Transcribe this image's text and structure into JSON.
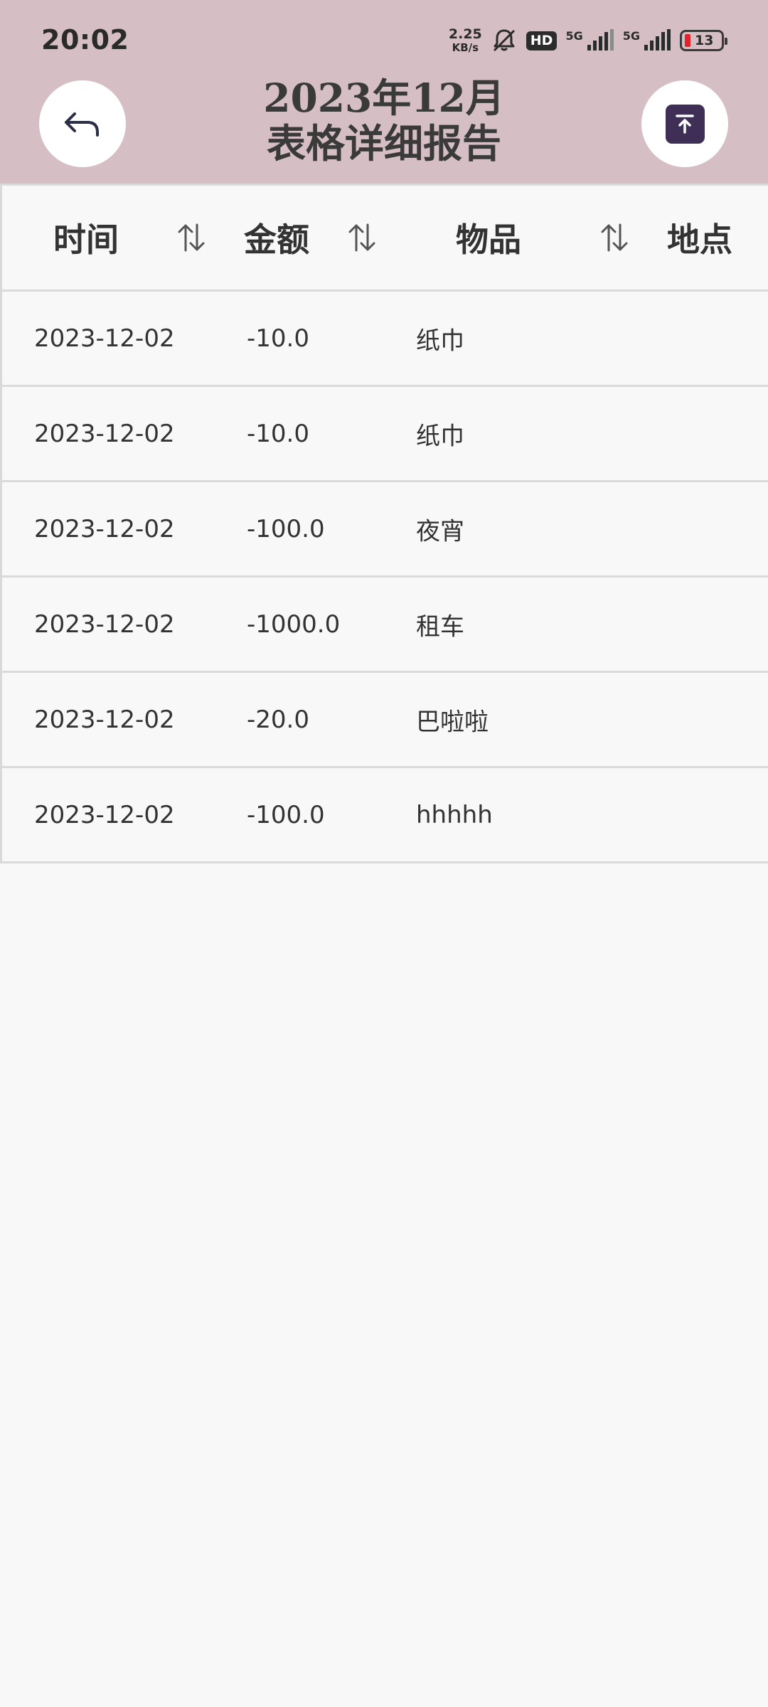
{
  "status_bar": {
    "time": "20:02",
    "net_speed_value": "2.25",
    "net_speed_unit": "KB/s",
    "hd_label": "HD",
    "sim1_label": "5G",
    "sim2_label": "5G",
    "battery": "13"
  },
  "header": {
    "title_line1": "2023年12月",
    "title_line2": "表格详细报告",
    "back_icon": "back-arrow-icon",
    "top_icon": "scroll-to-top-icon",
    "bg_color": "#d6bfc4"
  },
  "table": {
    "columns": [
      "时间",
      "金额",
      "物品",
      "地点"
    ],
    "rows": [
      {
        "date": "2023-12-02",
        "amount": "-10.0",
        "item": "纸巾"
      },
      {
        "date": "2023-12-02",
        "amount": "-10.0",
        "item": "纸巾"
      },
      {
        "date": "2023-12-02",
        "amount": "-100.0",
        "item": "夜宵"
      },
      {
        "date": "2023-12-02",
        "amount": "-1000.0",
        "item": "租车"
      },
      {
        "date": "2023-12-02",
        "amount": "-20.0",
        "item": "巴啦啦"
      },
      {
        "date": "2023-12-02",
        "amount": "-100.0",
        "item": "hhhhh"
      }
    ]
  }
}
